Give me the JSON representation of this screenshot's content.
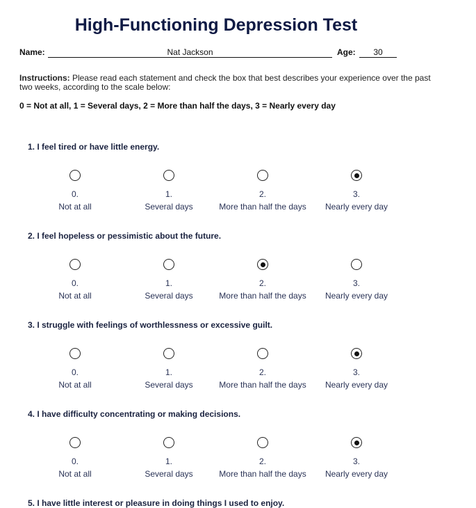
{
  "document": {
    "title": "High-Functioning Depression Test",
    "name_label": "Name:",
    "name_value": "Nat Jackson",
    "age_label": "Age:",
    "age_value": "30",
    "instructions_label": "Instructions:",
    "instructions_text": " Please read each statement and check the box that best describes your experience over the past two weeks, according to the scale below:",
    "scale_text": "0 = Not at all, 1 = Several days, 2 = More than half the days, 3 = Nearly every day"
  },
  "options": [
    {
      "num": "0.",
      "label": "Not at all"
    },
    {
      "num": "1.",
      "label": "Several days"
    },
    {
      "num": "2.",
      "label": "More than half the days"
    },
    {
      "num": "3.",
      "label": "Nearly every day"
    }
  ],
  "questions": [
    {
      "text": "1. I feel tired or have little energy.",
      "selected": 3
    },
    {
      "text": "2. I feel hopeless or pessimistic about the future.",
      "selected": 2
    },
    {
      "text": "3. I struggle with feelings of worthlessness or excessive guilt.",
      "selected": 3
    },
    {
      "text": "4. I have difficulty concentrating or making decisions.",
      "selected": 3
    },
    {
      "text": "5. I have little interest or pleasure in doing things I used to enjoy.",
      "selected": null
    }
  ]
}
